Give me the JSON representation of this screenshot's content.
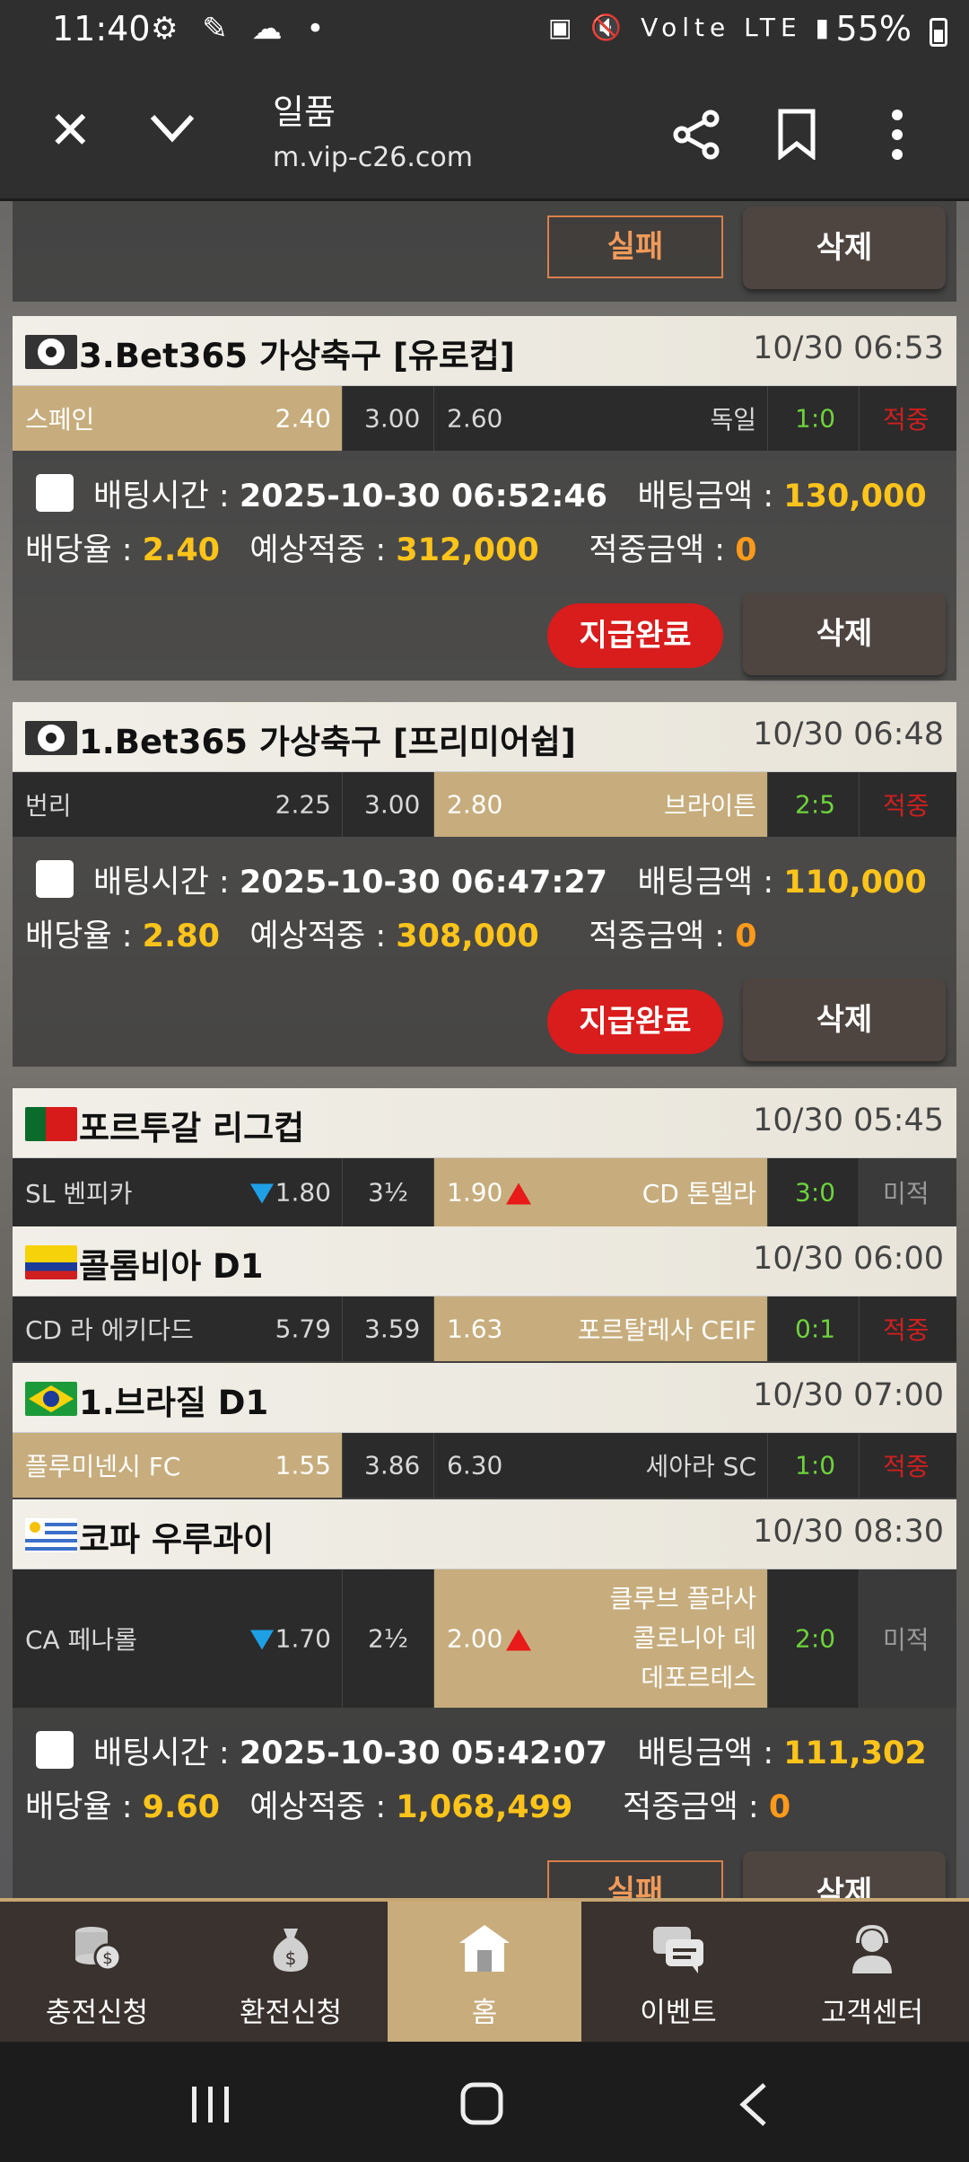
{
  "status_bar": {
    "time": "11:40",
    "icons_left": "⚙ ✎ ☁ •",
    "icons_right": "▣ 🔇 Volte LTE ▮",
    "battery": "55%"
  },
  "toolbar": {
    "title": "일품",
    "url": "m.vip-c26.com",
    "close_icon": "close-icon",
    "down_icon": "chevron-down-icon",
    "share_icon": "share-icon",
    "bookmark_icon": "bookmark-icon",
    "more_icon": "more-icon"
  },
  "top_buttons": {
    "fail": "실패",
    "delete": "삭제"
  },
  "bets": [
    {
      "league": "3.Bet365 가상축구 [유로컵]",
      "time": "10/30 06:53",
      "home": "스페인",
      "home_odds": "2.40",
      "draw": "3.00",
      "away_odds": "2.60",
      "away": "독일",
      "score": "1:0",
      "result": "적중",
      "bet_time_label": "배팅시간 :",
      "bet_time": "2025-10-30 06:52:46",
      "amount_label": "배팅금액 :",
      "amount": "130,000",
      "odds_label": "배당율 :",
      "odds": "2.40",
      "expected_label": "예상적중 :",
      "expected": "312,000",
      "win_label": "적중금액 :",
      "win": "0",
      "status_btn": "지급완료",
      "delete_btn": "삭제"
    },
    {
      "league": "1.Bet365 가상축구 [프리미어쉽]",
      "time": "10/30 06:48",
      "home": "번리",
      "home_odds": "2.25",
      "draw": "3.00",
      "away_odds": "2.80",
      "away": "브라이튼",
      "score": "2:5",
      "result": "적중",
      "bet_time_label": "배팅시간 :",
      "bet_time": "2025-10-30 06:47:27",
      "amount_label": "배팅금액 :",
      "amount": "110,000",
      "odds_label": "배당율 :",
      "odds": "2.80",
      "expected_label": "예상적중 :",
      "expected": "308,000",
      "win_label": "적중금액 :",
      "win": "0",
      "status_btn": "지급완료",
      "delete_btn": "삭제"
    }
  ],
  "combo": {
    "matches": [
      {
        "league": "포르투갈 리그컵",
        "time": "10/30 05:45",
        "home": "SL 벤피카",
        "home_odds": "1.80",
        "draw": "3½",
        "away_odds": "1.90",
        "away": "CD 톤델라",
        "score": "3:0",
        "result": "미적"
      },
      {
        "league": "콜롬비아 D1",
        "time": "10/30 06:00",
        "home": "CD 라 에키다드",
        "home_odds": "5.79",
        "draw": "3.59",
        "away_odds": "1.63",
        "away": "포르탈레사 CEIF",
        "score": "0:1",
        "result": "적중"
      },
      {
        "league": "1.브라질 D1",
        "time": "10/30 07:00",
        "home": "플루미넨시 FC",
        "home_odds": "1.55",
        "draw": "3.86",
        "away_odds": "6.30",
        "away": "세아라 SC",
        "score": "1:0",
        "result": "적중"
      },
      {
        "league": "코파 우루과이",
        "time": "10/30 08:30",
        "home": "CA 페나롤",
        "home_odds": "1.70",
        "draw": "2½",
        "away_odds": "2.00",
        "away_line1": "클루브 플라사",
        "away_line2": "콜로니아 데",
        "away_line3": "데포르테스",
        "score": "2:0",
        "result": "미적"
      }
    ],
    "bet_time_label": "배팅시간 :",
    "bet_time": "2025-10-30 05:42:07",
    "amount_label": "배팅금액 :",
    "amount": "111,302",
    "odds_label": "배당율 :",
    "odds": "9.60",
    "expected_label": "예상적중 :",
    "expected": "1,068,499",
    "win_label": "적중금액 :",
    "win": "0",
    "fail_btn": "실패",
    "delete_btn": "삭제"
  },
  "bottom_nav": [
    {
      "label": "충전신청",
      "icon": "coins-icon"
    },
    {
      "label": "환전신청",
      "icon": "money-bag-icon"
    },
    {
      "label": "홈",
      "icon": "home-icon"
    },
    {
      "label": "이벤트",
      "icon": "chat-icon"
    },
    {
      "label": "고객센터",
      "icon": "support-icon"
    }
  ],
  "colors": {
    "gold": "#c7ad7d",
    "yellow": "#ffc41a",
    "orange": "#ff9a1a",
    "green": "#6ed33c",
    "red": "#d01f1f",
    "paid": "#d91c1c"
  }
}
